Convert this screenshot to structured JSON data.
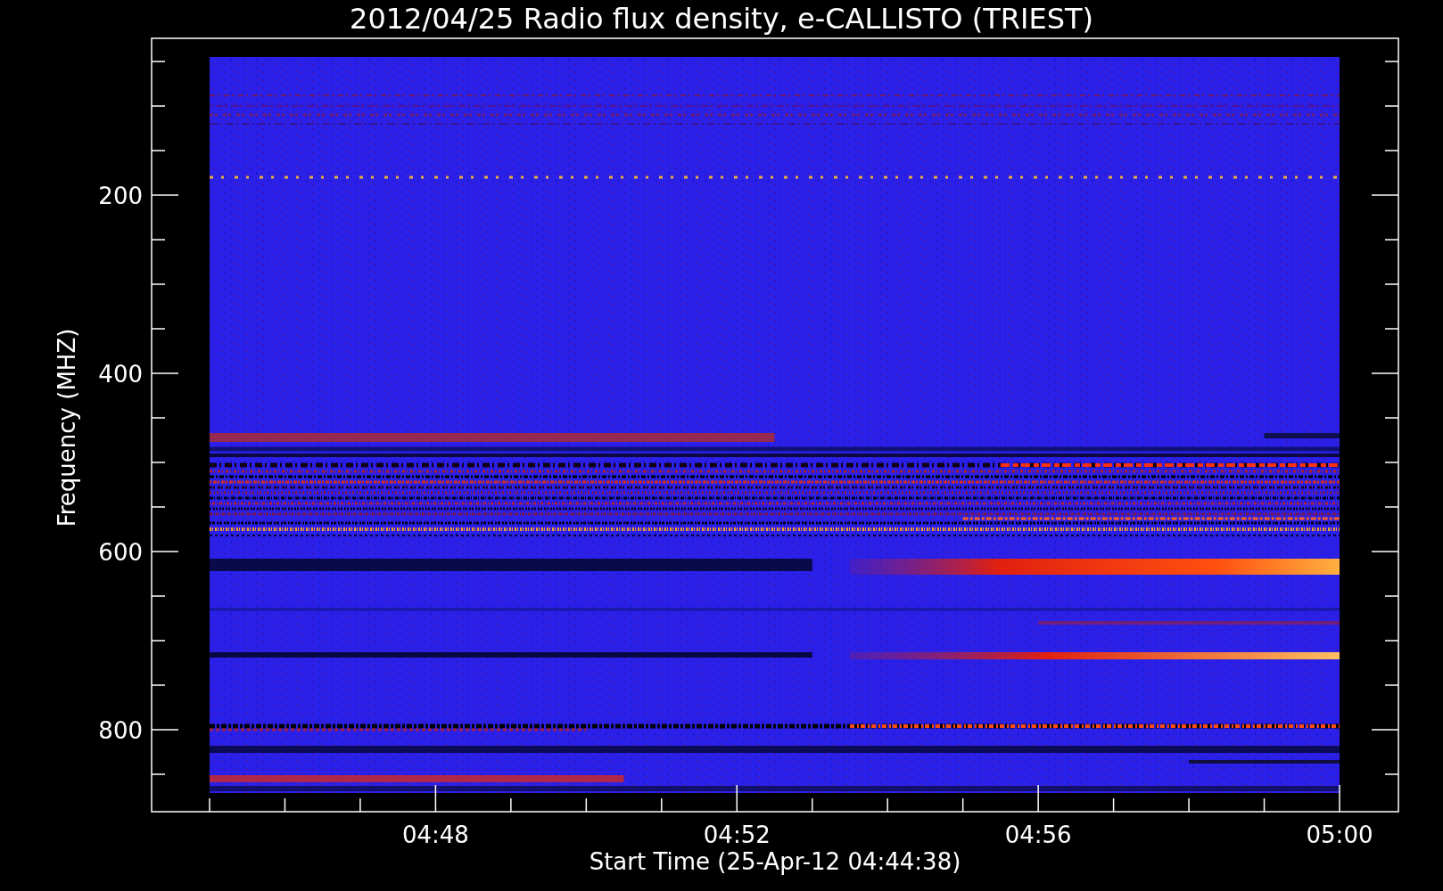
{
  "title": "2012/04/25  Radio flux density, e-CALLISTO (TRIEST)",
  "y_axis": {
    "label": "Frequency (MHZ)",
    "ticks": [
      "200",
      "400",
      "600",
      "800"
    ]
  },
  "x_axis": {
    "label": "Start Time (25-Apr-12 04:44:38)",
    "ticks": [
      "04:48",
      "04:52",
      "04:56",
      "05:00"
    ]
  }
}
